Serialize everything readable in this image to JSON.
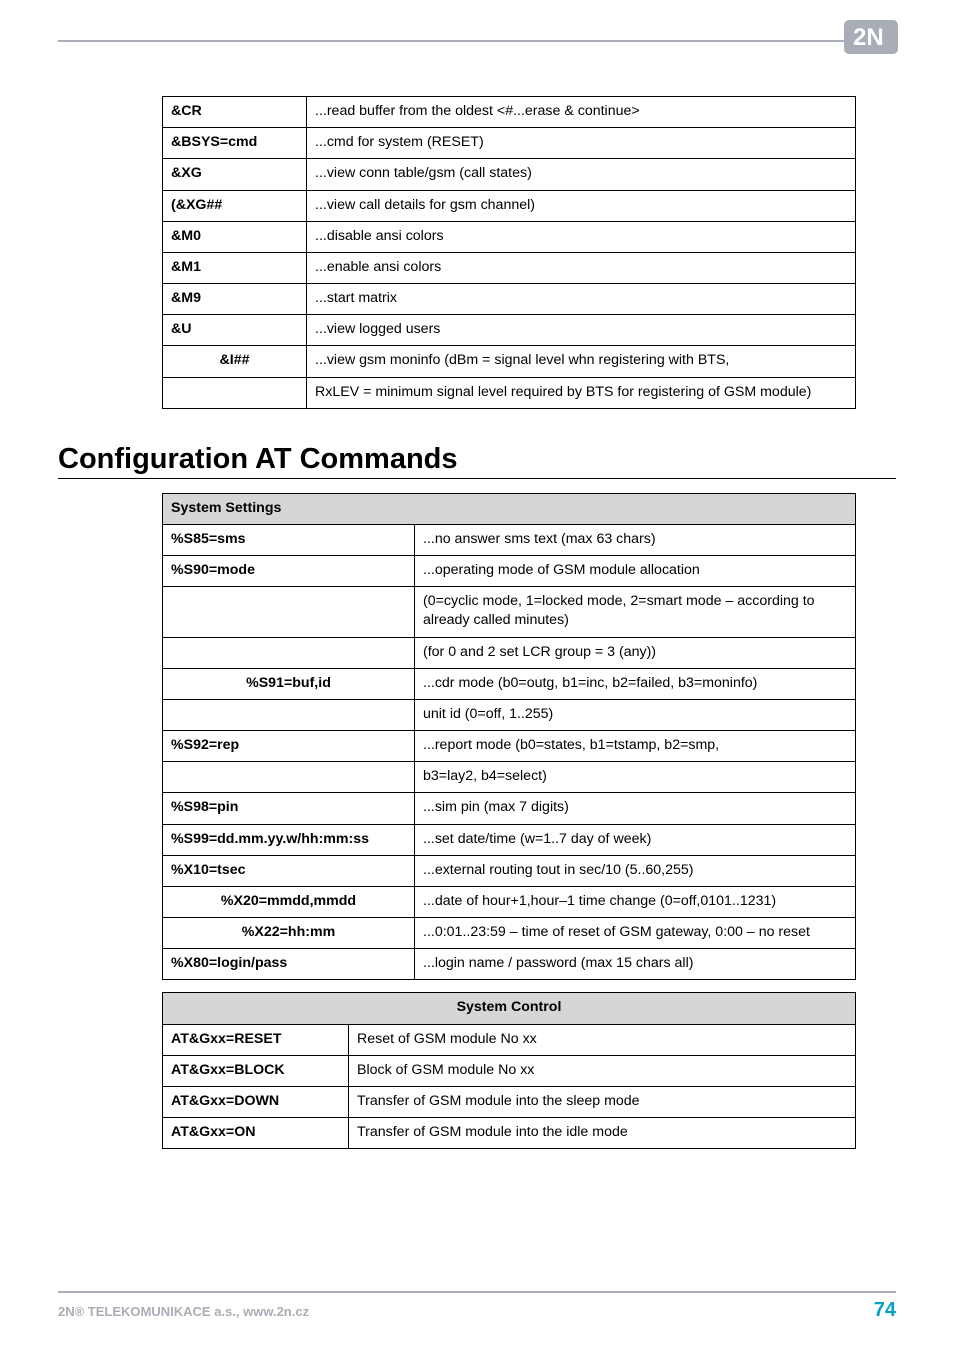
{
  "logo": {
    "name": "2N-logo"
  },
  "tables": {
    "top": [
      {
        "cmd": "&CR",
        "desc": "...read buffer from the oldest <#...erase & continue>"
      },
      {
        "cmd": "&BSYS=cmd",
        "desc": "...cmd for system (RESET)"
      },
      {
        "cmd": "&XG",
        "desc": "...view conn table/gsm (call states)"
      },
      {
        "cmd": "(&XG##",
        "desc": "...view call details for gsm channel)"
      },
      {
        "cmd": "&M0",
        "desc": "...disable ansi colors"
      },
      {
        "cmd": "&M1",
        "desc": "...enable ansi colors"
      },
      {
        "cmd": "&M9",
        "desc": "...start matrix"
      },
      {
        "cmd": "&U",
        "desc": "...view logged users"
      },
      {
        "cmd": "&I##",
        "desc": "...view gsm moninfo (dBm = signal level whn registering with BTS,",
        "center": true
      },
      {
        "cmd": "",
        "desc": "RxLEV = minimum signal level required by BTS for registering of GSM module)"
      }
    ],
    "settings_header": "System Settings",
    "settings": [
      {
        "cmd": "%S85=sms",
        "desc": "...no answer sms text (max 63 chars)"
      },
      {
        "cmd": "%S90=mode",
        "desc": "...operating mode of GSM module allocation"
      },
      {
        "cmd": "",
        "desc": "(0=cyclic mode, 1=locked mode, 2=smart mode – according to already called minutes)"
      },
      {
        "cmd": "",
        "desc": "(for 0 and 2 set LCR group = 3 (any))"
      },
      {
        "cmd": "%S91=buf,id",
        "desc": "...cdr mode (b0=outg, b1=inc, b2=failed, b3=moninfo)",
        "center": true
      },
      {
        "cmd": "",
        "desc": "unit id (0=off, 1..255)"
      },
      {
        "cmd": "%S92=rep",
        "desc": "...report mode (b0=states, b1=tstamp, b2=smp,"
      },
      {
        "cmd": "",
        "desc": "b3=lay2, b4=select)"
      },
      {
        "cmd": "%S98=pin",
        "desc": "...sim pin (max 7 digits)"
      },
      {
        "cmd": "%S99=dd.mm.yy.w/hh:mm:ss",
        "desc": "...set date/time (w=1..7 day of week)"
      },
      {
        "cmd": "%X10=tsec",
        "desc": "...external routing tout in sec/10 (5..60,255)"
      },
      {
        "cmd": "%X20=mmdd,mmdd",
        "desc": "...date of hour+1,hour–1 time change (0=off,0101..1231)",
        "center": true
      },
      {
        "cmd": "%X22=hh:mm",
        "desc": "...0:01..23:59 – time of reset of GSM gateway, 0:00 – no reset",
        "center": true
      },
      {
        "cmd": "%X80=login/pass",
        "desc": "...login name / password (max 15 chars all)"
      }
    ],
    "control_header": "System Control",
    "control": [
      {
        "cmd": "AT&Gxx=RESET",
        "desc": "Reset of GSM module No xx"
      },
      {
        "cmd": "AT&Gxx=BLOCK",
        "desc": "Block of GSM module No xx"
      },
      {
        "cmd": "AT&Gxx=DOWN",
        "desc": "Transfer of GSM module into the sleep mode"
      },
      {
        "cmd": "AT&Gxx=ON",
        "desc": "Transfer of GSM module into the idle mode"
      }
    ]
  },
  "heading": "Configuration AT Commands",
  "footer": {
    "left": "2N® TELEKOMUNIKACE a.s., www.2n.cz",
    "page": "74"
  }
}
